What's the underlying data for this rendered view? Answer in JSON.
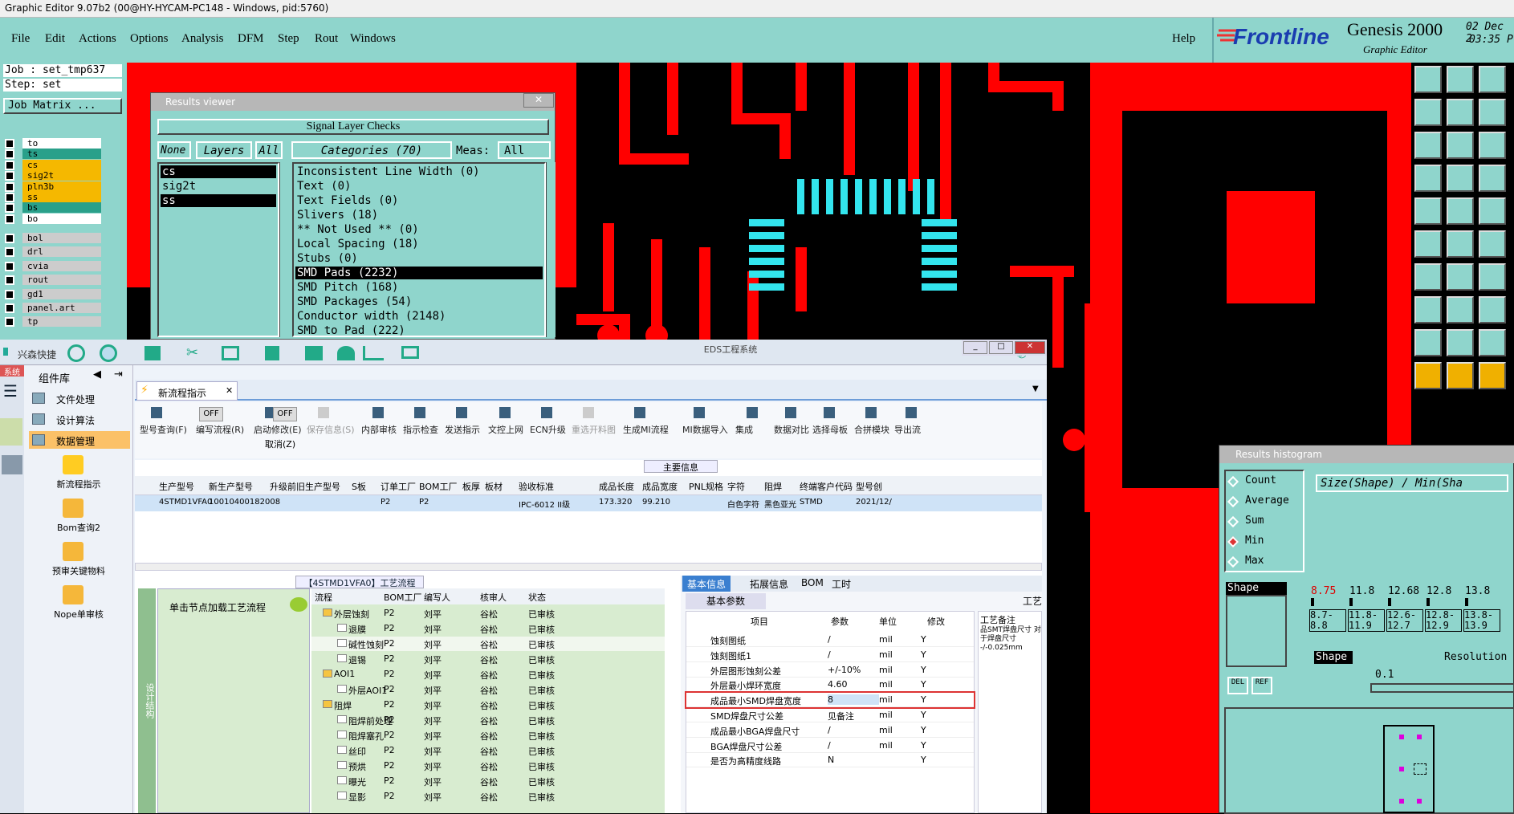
{
  "window_title": "Graphic Editor 9.07b2 (00@HY-HYCAM-PC148 - Windows, pid:5760)",
  "menu": [
    "File",
    "Edit",
    "Actions",
    "Options",
    "Analysis",
    "DFM",
    "Step",
    "Rout",
    "Windows"
  ],
  "help": "Help",
  "brand": {
    "logo": "Frontline",
    "product": "Genesis 2000",
    "sub": "Graphic Editor",
    "date": "02 Dec 2",
    "time": "03:35 P"
  },
  "job": {
    "job_label": "Job : set_tmp637",
    "step_label": "Step: set",
    "matrix_btn": "Job Matrix ..."
  },
  "layers": [
    {
      "name": "to",
      "bg": "#ffffff"
    },
    {
      "name": "ts",
      "bg": "#2aa08a"
    },
    {
      "name": "cs",
      "bg": "#f5b800"
    },
    {
      "name": "sig2t",
      "bg": "#f5b800"
    },
    {
      "name": "pln3b",
      "bg": "#f5b800"
    },
    {
      "name": "ss",
      "bg": "#f5b800"
    },
    {
      "name": "bs",
      "bg": "#2aa08a"
    },
    {
      "name": "bo",
      "bg": "#ffffff"
    },
    {
      "name": "bol",
      "bg": "#ccc"
    },
    {
      "name": "drl",
      "bg": "#ccc"
    },
    {
      "name": "cvia",
      "bg": "#ccc"
    },
    {
      "name": "rout",
      "bg": "#ccc"
    },
    {
      "name": "gd1",
      "bg": "#ccc"
    },
    {
      "name": "panel.art",
      "bg": "#ccc"
    },
    {
      "name": "tp",
      "bg": "#ccc"
    }
  ],
  "results_viewer": {
    "title": "Results viewer",
    "header": "Signal Layer Checks",
    "none_btn": "None",
    "layers_btn": "Layers",
    "all_btn": "All",
    "categories": "Categories (70)",
    "meas_label": "Meas:",
    "meas_value": "All",
    "layer_list": [
      "cs",
      "sig2t",
      "ss"
    ],
    "items": [
      "Inconsistent Line Width (0)",
      "Text (0)",
      "Text Fields (0)",
      "Slivers (18)",
      "** Not Used ** (0)",
      "Local Spacing (18)",
      "Stubs (0)",
      "SMD Pads (2232)",
      "SMD Pitch (168)",
      "SMD Packages (54)",
      "Conductor width (2148)",
      "SMD to Pad (222)"
    ],
    "selected_index": 7
  },
  "eds": {
    "window_title": "EDS工程系统",
    "app_name": "兴森快捷",
    "sidebar_tab": "系统",
    "component_lib": "组件库",
    "tab_title": "新流程指示",
    "left_items": [
      "文件处理",
      "设计算法",
      "数据管理"
    ],
    "left_icons": [
      "新流程指示",
      "Bom查询2",
      "预审关键物料",
      "Nope单审核"
    ],
    "toolbar": [
      "型号查询(F)",
      "编写流程(R)",
      "启动修改(E)",
      "保存信息(S)",
      "内部审核",
      "指示检查",
      "发送指示",
      "文控上网",
      "ECN升级",
      "重选开料图",
      "生成MI流程",
      "MI数据导入",
      "集成",
      "数据对比",
      "选择母板",
      "合拼模块",
      "导出流"
    ],
    "toggle_off": "OFF",
    "cancel_label": "取消(Z)",
    "main_info": "主要信息",
    "grid_headers": [
      "生产型号",
      "新生产型号",
      "升级前旧生产型号",
      "S板",
      "订单工厂",
      "BOM工厂",
      "板厚",
      "板材",
      "验收标准",
      "成品长度",
      "成品宽度",
      "PNL规格",
      "字符",
      "阻焊",
      "终端客户代码",
      "型号创"
    ],
    "grid_row": [
      "4STMD1VFA0",
      "10010400182008",
      "",
      "",
      "P2",
      "P2",
      "",
      "",
      "IPC-6012 II级",
      "173.320",
      "99.210",
      "",
      "白色字符",
      "黑色亚光",
      "STMD",
      "2021/12/"
    ],
    "flow_title": "【4STMD1VFA0】工艺流程",
    "design_struct": "设计结构",
    "single_node": "单击节点加载工艺流程",
    "flow_headers": [
      "流程",
      "BOM工厂",
      "编写人",
      "核审人",
      "状态"
    ],
    "flow_rows": [
      [
        "外层蚀刻",
        "P2",
        "刘平",
        "谷松",
        "已审核"
      ],
      [
        "退膜",
        "P2",
        "刘平",
        "谷松",
        "已审核"
      ],
      [
        "碱性蚀刻",
        "P2",
        "刘平",
        "谷松",
        "已审核"
      ],
      [
        "退锡",
        "P2",
        "刘平",
        "谷松",
        "已审核"
      ],
      [
        "AOI1",
        "P2",
        "刘平",
        "谷松",
        "已审核"
      ],
      [
        "外层AOI1",
        "P2",
        "刘平",
        "谷松",
        "已审核"
      ],
      [
        "阻焊",
        "P2",
        "刘平",
        "谷松",
        "已审核"
      ],
      [
        "阻焊前处理",
        "P2",
        "刘平",
        "谷松",
        "已审核"
      ],
      [
        "阻焊塞孔",
        "P2",
        "刘平",
        "谷松",
        "已审核"
      ],
      [
        "丝印",
        "P2",
        "刘平",
        "谷松",
        "已审核"
      ],
      [
        "预烘",
        "P2",
        "刘平",
        "谷松",
        "已审核"
      ],
      [
        "曝光",
        "P2",
        "刘平",
        "谷松",
        "已审核"
      ],
      [
        "显影",
        "P2",
        "刘平",
        "谷松",
        "已审核"
      ]
    ],
    "detail_tabs": [
      "基本信息",
      "拓展信息",
      "BOM",
      "工时"
    ],
    "basic_params": "基本参数",
    "craft": "工艺",
    "craft_note": "工艺备注",
    "craft_note_text": "品SMT焊盘尺寸 对于焊盘尺寸 -/-0.025mm",
    "param_headers": [
      "项目",
      "参数",
      "单位",
      "修改"
    ],
    "params": [
      [
        "蚀刻图纸",
        "/",
        "mil",
        "Y"
      ],
      [
        "蚀刻图纸1",
        "/",
        "mil",
        "Y"
      ],
      [
        "外层图形蚀刻公差",
        "+/-10%",
        "mil",
        "Y"
      ],
      [
        "外层最小焊环宽度",
        "4.60",
        "mil",
        "Y"
      ],
      [
        "成品最小SMD焊盘宽度",
        "8",
        "mil",
        "Y"
      ],
      [
        "SMD焊盘尺寸公差",
        "见备注",
        "mil",
        "Y"
      ],
      [
        "成品最小BGA焊盘尺寸",
        "/",
        "mil",
        "Y"
      ],
      [
        "BGA焊盘尺寸公差",
        "/",
        "mil",
        "Y"
      ],
      [
        "是否为高精度线路",
        "N",
        "",
        "Y"
      ]
    ]
  },
  "histogram": {
    "title": "Results histogram",
    "options": [
      "Count",
      "Average",
      "Sum",
      "Min",
      "Max"
    ],
    "selected": "Min",
    "field": "Size(Shape) / Min(Sha",
    "shape": "Shape",
    "values": [
      "8.75",
      "11.8",
      "12.68",
      "12.8",
      "13.8"
    ],
    "ranges": [
      "8.7-8.8",
      "11.8-11.9",
      "12.6-12.7",
      "12.8-12.9",
      "13.8-13.9"
    ],
    "resolution_label": "Resolution",
    "resolution_value": "0.1",
    "del_btn": "DEL",
    "ref_btn": "REF"
  },
  "colors": {
    "copper": "#ff0000",
    "pads": "#33e5ee",
    "panel": "#8fd5cc"
  }
}
